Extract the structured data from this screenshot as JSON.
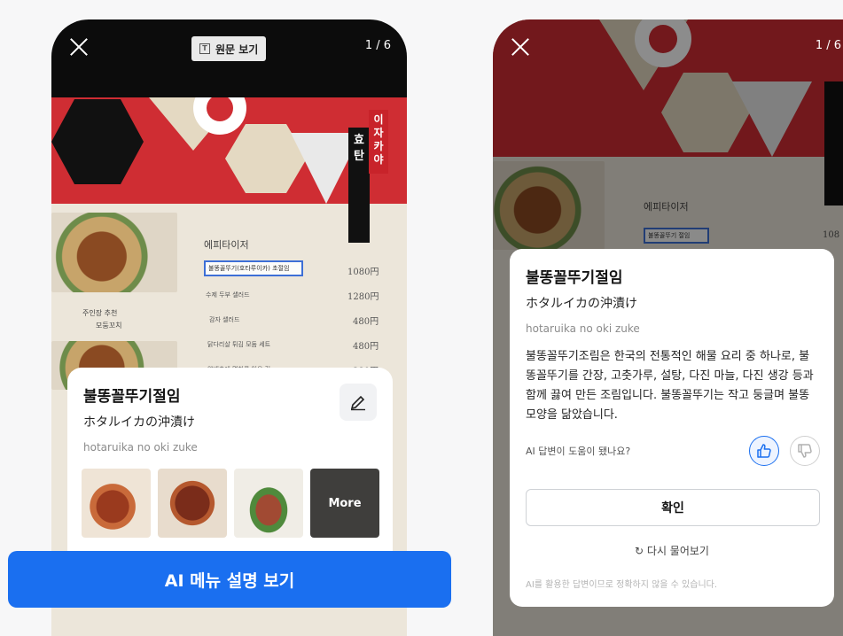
{
  "left_screen": {
    "toolbar": {
      "original_view_label": "원문 보기",
      "original_view_icon_glyph": "T",
      "page_counter": "1 / 6"
    },
    "menu_photo": {
      "sign_hyotan": "효\n탄",
      "sign_izakaya": "이\n자\n카\n야",
      "section_heading": "에피타이저",
      "highlighted_item": "불똥꼴뚜기(호타루이카) 초절임",
      "rows": [
        {
          "name": "수제 두부 샐러드",
          "price": "1280円"
        },
        {
          "name": "감자 샐러드",
          "price": "480円"
        },
        {
          "name": "닭다리살 튀김 모둠 세트",
          "price": "480円"
        },
        {
          "name": "양배추에 명치를 얹은 것",
          "price": "380円"
        }
      ],
      "highlighted_price": "1080円",
      "photo_caption_1": "주인장 추천",
      "photo_caption_2": "모둠꼬치"
    },
    "card": {
      "title": "불똥꼴뚜기절임",
      "japanese": "ホタルイカの沖漬け",
      "romaji": "hotaruika no oki zuke",
      "edit_icon": "pencil-icon",
      "more_label": "More"
    },
    "cta_label": "AI 메뉴 설명 보기"
  },
  "right_screen": {
    "toolbar": {
      "page_counter": "1 / 6"
    },
    "menu_photo": {
      "section_heading": "에피타이저",
      "highlighted_item": "불똥꼴뚜기 절임",
      "price_fragment": "108"
    },
    "modal": {
      "title": "불똥꼴뚜기절임",
      "japanese": "ホタルイカの沖漬け",
      "romaji": "hotaruika no oki zuke",
      "description": "불똥꼴뚜기조림은 한국의 전통적인 해물 요리 중 하나로, 불똥꼴뚜기를 간장, 고춧가루, 설탕, 다진 마늘, 다진 생강 등과 함께 끓여 만든 조림입니다. 불똥꼴뚜기는 작고 둥글며 불똥모양을 닮았습니다.",
      "feedback_question": "AI 답변이 도움이 됐나요?",
      "thumbs_up_icon": "thumbs-up-icon",
      "thumbs_down_icon": "thumbs-down-icon",
      "confirm_label": "확인",
      "retry_label": "다시 물어보기",
      "disclaimer": "AI를 활용한 답변이므로 정확하지 않을 수 있습니다."
    }
  },
  "colors": {
    "accent": "#1a6ff0",
    "menu_red": "#cf2d33",
    "phone_frame": "#0c0c0c"
  }
}
